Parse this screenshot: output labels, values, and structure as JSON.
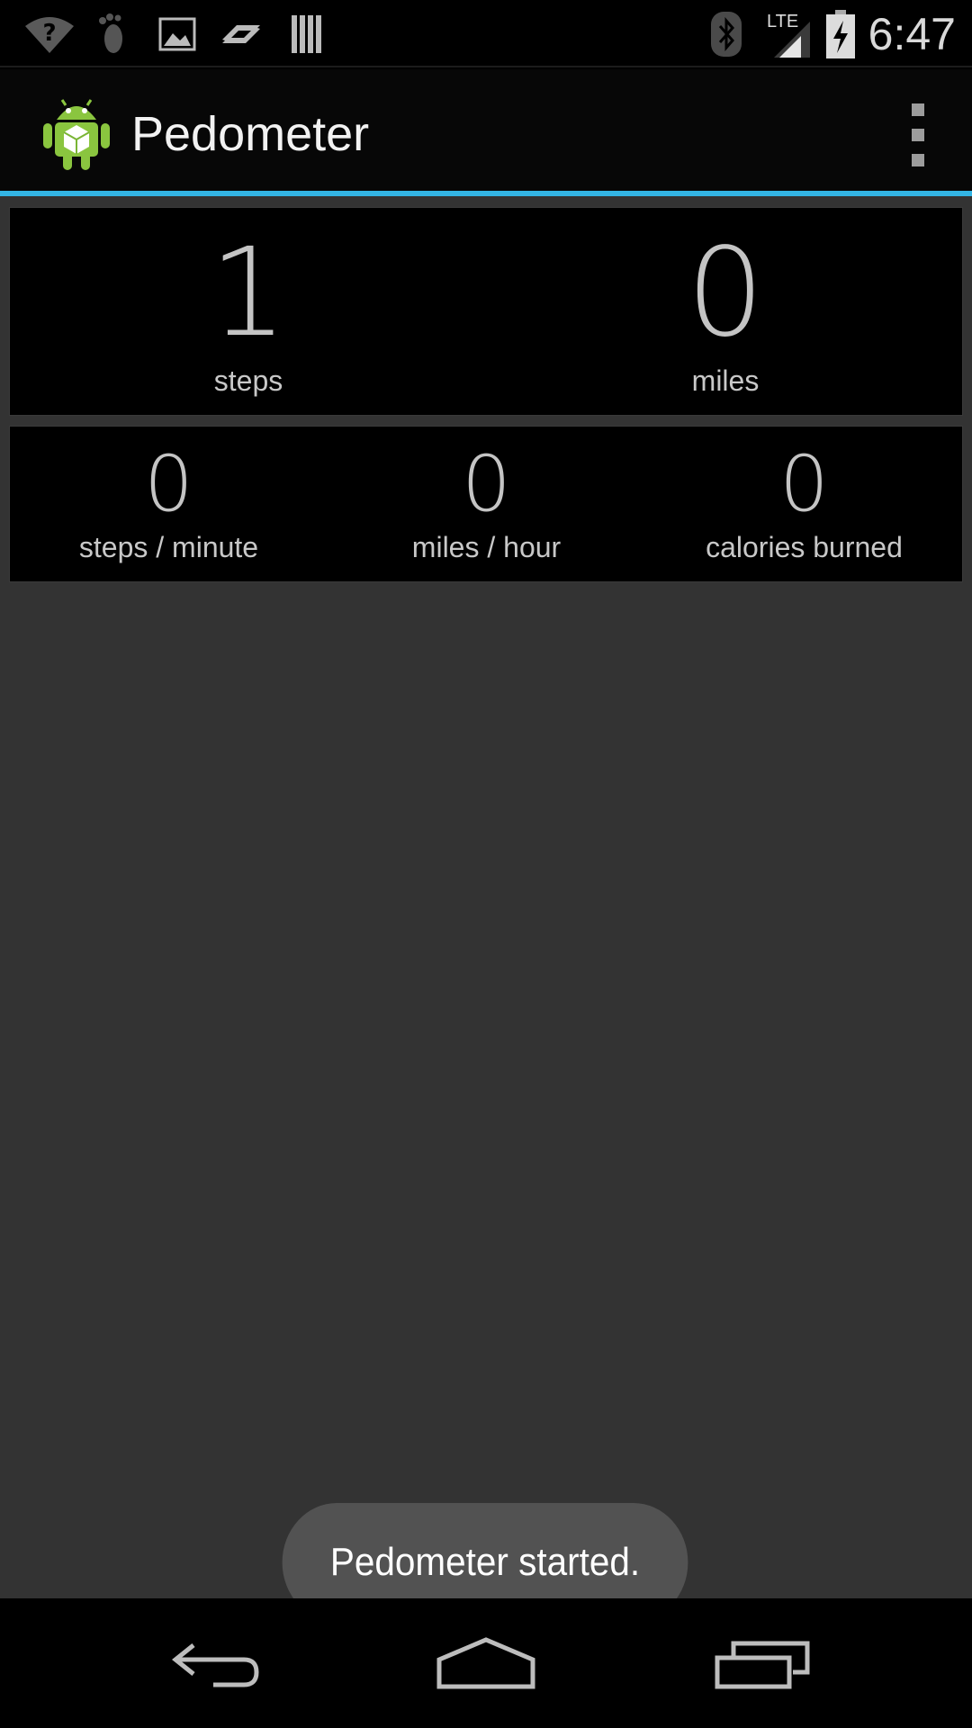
{
  "status_bar": {
    "time": "6:47",
    "network_label": "LTE",
    "left_icons": [
      "wifi-question-icon",
      "footprint-icon",
      "gallery-icon",
      "sync-arrows-icon",
      "barcode-icon"
    ],
    "right_icons": [
      "bluetooth-icon",
      "lte-signal-icon",
      "battery-charging-icon"
    ]
  },
  "action_bar": {
    "title": "Pedometer",
    "app_icon": "android-app-icon",
    "overflow_icon": "overflow-menu-icon",
    "accent_color": "#33b5e5"
  },
  "stats": {
    "steps": {
      "value": "1",
      "label": "steps"
    },
    "miles": {
      "value": "0",
      "label": "miles"
    },
    "pace": {
      "value": "0",
      "label": "steps / minute"
    },
    "speed": {
      "value": "0",
      "label": "miles / hour"
    },
    "calories": {
      "value": "0",
      "label": "calories burned"
    }
  },
  "toast": {
    "message": "Pedometer started."
  },
  "nav_bar": {
    "buttons": [
      "back-icon",
      "home-icon",
      "recent-apps-icon"
    ]
  }
}
